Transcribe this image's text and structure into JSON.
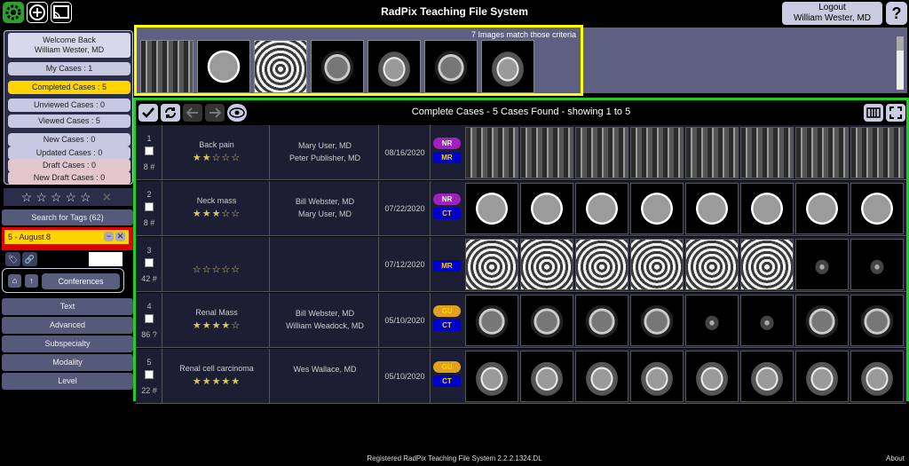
{
  "app": {
    "title": "RadPix Teaching File System",
    "logout_label": "Logout",
    "user_name": "William Wester, MD",
    "help_label": "?"
  },
  "sidebar": {
    "welcome_line1": "Welcome Back",
    "welcome_line2": "William Wester, MD",
    "my_cases": "My Cases : 1",
    "completed_cases": "Completed Cases : 5",
    "unviewed_cases": "Unviewed Cases : 0",
    "viewed_cases": "Viewed Cases : 5",
    "new_cases": "New Cases : 0",
    "updated_cases": "Updated Cases : 0",
    "draft_cases": "Draft Cases : 0",
    "new_draft_cases": "New Draft Cases : 0",
    "rating_stars": "☆☆☆☆☆",
    "rating_clear": "✕",
    "search_tags": "Search for Tags (62)",
    "tag_label": "5 - August 8",
    "conferences": "Conferences",
    "filters": [
      "Text",
      "Advanced",
      "Subspecialty",
      "Modality",
      "Level"
    ]
  },
  "matches": {
    "text": "7 Images match those criteria",
    "thumbs": [
      "spine",
      "brain",
      "pelvis",
      "abd",
      "abd2",
      "abd",
      "abd2"
    ]
  },
  "results": {
    "title": "Complete Cases - 5 Cases Found - showing 1 to 5",
    "rows": [
      {
        "num": "1",
        "count": "8 #",
        "title": "Back pain",
        "stars": "★★☆☆☆",
        "author1": "Mary User, MD",
        "author2": "Peter Publisher, MD",
        "date": "08/16/2020",
        "tag1": "NR",
        "tag2": "MR",
        "img": "spine"
      },
      {
        "num": "2",
        "count": "8 #",
        "title": "Neck mass",
        "stars": "★★★☆☆",
        "author1": "Bill Webster, MD",
        "author2": "Mary User, MD",
        "date": "07/22/2020",
        "tag1": "NR",
        "tag2": "CT",
        "img": "brain"
      },
      {
        "num": "3",
        "count": "42 #",
        "title": "",
        "stars": "☆☆☆☆☆",
        "author1": "",
        "author2": "",
        "date": "07/12/2020",
        "tag1": "",
        "tag2": "MR",
        "img": "pelvis"
      },
      {
        "num": "4",
        "count": "86 ?",
        "title": "Renal Mass",
        "stars": "★★★★☆",
        "author1": "Bill Webster, MD",
        "author2": "William Weadock, MD",
        "date": "05/10/2020",
        "tag1": "GU",
        "tag2": "CT",
        "img": "abd"
      },
      {
        "num": "5",
        "count": "22 #",
        "title": "Renal cell carcinoma",
        "stars": "★★★★★",
        "author1": "Wes Wallace, MD",
        "author2": "",
        "date": "05/10/2020",
        "tag1": "GU",
        "tag2": "CT",
        "img": "abd2"
      }
    ]
  },
  "footer": {
    "text": "Registered RadPix Teaching File System 2.2.2.1324.DL",
    "about": "About"
  },
  "colors": {
    "accent_green": "#22cc22",
    "highlight_yellow": "#ffff00",
    "nr_badge": "#a020c0",
    "modality_badge": "#0000cc",
    "gu_badge": "#e0a020"
  }
}
